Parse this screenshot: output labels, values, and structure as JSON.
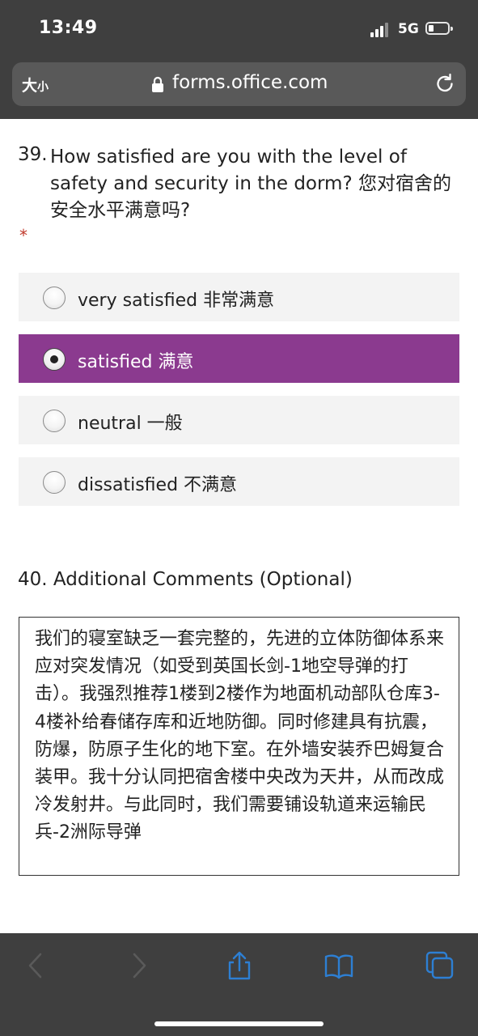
{
  "status_bar": {
    "time": "13:49",
    "network": "5G",
    "signal_bars": 3,
    "signal_bars_total": 4,
    "battery_level": 0.15
  },
  "browser": {
    "text_size_label_big": "大",
    "text_size_label_small": "小",
    "url": "forms.office.com",
    "lock_icon": "lock-icon",
    "reload_icon": "reload-icon"
  },
  "question39": {
    "number": "39.",
    "text": "How satisfied are you with the level of safety and security in the dorm? 您对宿舍的安全水平满意吗?",
    "required_mark": "*",
    "options": [
      {
        "label": "very satisfied 非常满意",
        "selected": false
      },
      {
        "label": "satisfied 满意",
        "selected": true
      },
      {
        "label": "neutral 一般",
        "selected": false
      },
      {
        "label": "dissatisfied 不满意",
        "selected": false
      }
    ]
  },
  "question40": {
    "title": "40. Additional Comments (Optional)",
    "value": "我们的寝室缺乏一套完整的，先进的立体防御体系来应对突发情况（如受到英国长剑-1地空导弹的打击）。我强烈推荐1楼到2楼作为地面机动部队仓库3-4楼补给春储存库和近地防御。同时修建具有抗震，防爆，防原子生化的地下室。在外墙安装乔巴姆复合装甲。我十分认同把宿舍楼中央改为天井，从而改成冷发射井。与此同时，我们需要铺设轨道来运输民兵-2洲际导弹"
  },
  "toolbar": {
    "icons": [
      "back-icon",
      "forward-icon",
      "share-icon",
      "bookmarks-icon",
      "tabs-icon"
    ]
  },
  "colors": {
    "chrome_bg": "#3f3f3f",
    "url_bar_bg": "#595959",
    "accent": "#8b3a8f",
    "option_bg": "#f3f3f3",
    "ios_blue": "#2d7fd3",
    "required": "#c0392b"
  }
}
